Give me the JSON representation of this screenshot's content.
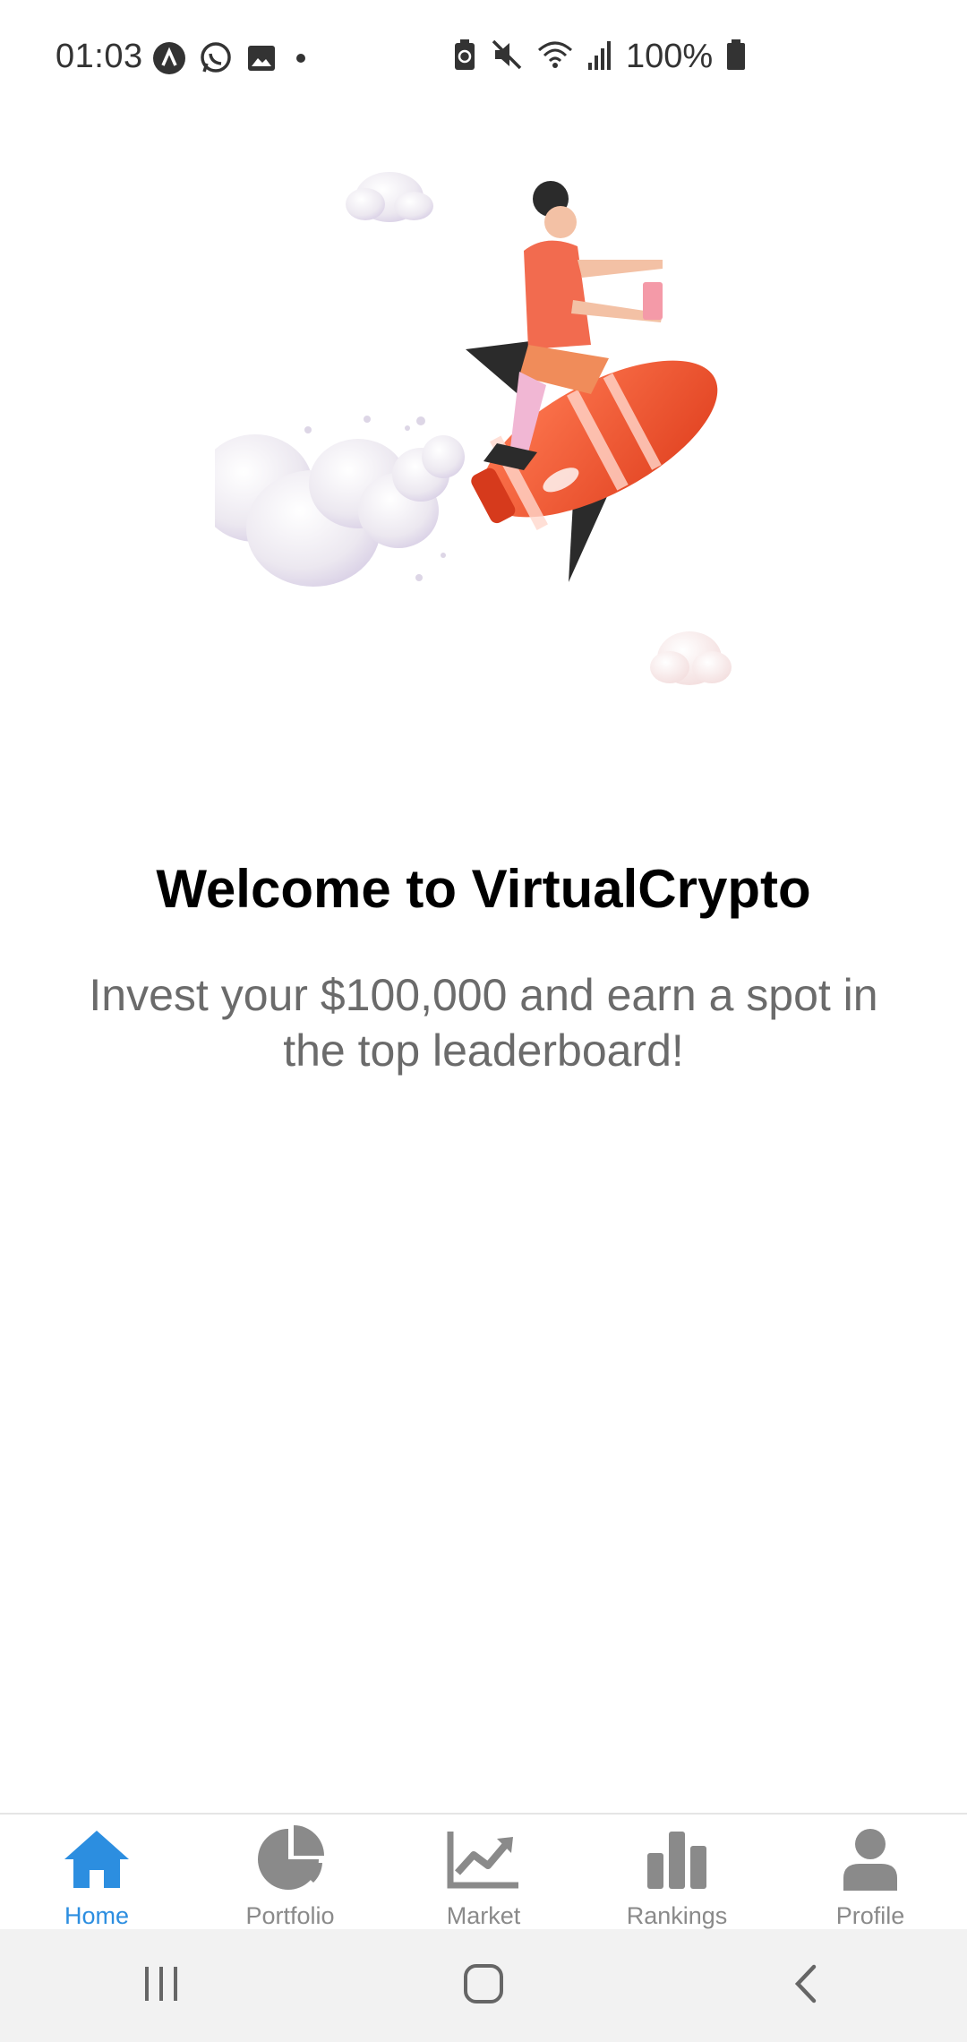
{
  "status_bar": {
    "time": "01:03",
    "battery_percent": "100%",
    "left_icons": [
      "app-a-icon",
      "whatsapp-icon",
      "gallery-icon",
      "dot-icon"
    ],
    "right_icons": [
      "battery-saver-icon",
      "mute-icon",
      "wifi-icon",
      "signal-icon",
      "battery-icon"
    ]
  },
  "hero": {
    "title": "Welcome to VirtualCrypto",
    "subtitle": "Invest your $100,000 and earn a spot in the top leaderboard!"
  },
  "bottom_nav": {
    "active_color": "#2c8ee0",
    "inactive_color": "#8a8a8a",
    "items": [
      {
        "label": "Home",
        "icon": "home-icon",
        "active": true
      },
      {
        "label": "Portfolio",
        "icon": "pie-chart-icon",
        "active": false
      },
      {
        "label": "Market",
        "icon": "trending-up-icon",
        "active": false
      },
      {
        "label": "Rankings",
        "icon": "bar-chart-icon",
        "active": false
      },
      {
        "label": "Profile",
        "icon": "person-icon",
        "active": false
      }
    ]
  },
  "system_nav": {
    "buttons": [
      "recent-apps-icon",
      "home-button-icon",
      "back-icon"
    ]
  }
}
